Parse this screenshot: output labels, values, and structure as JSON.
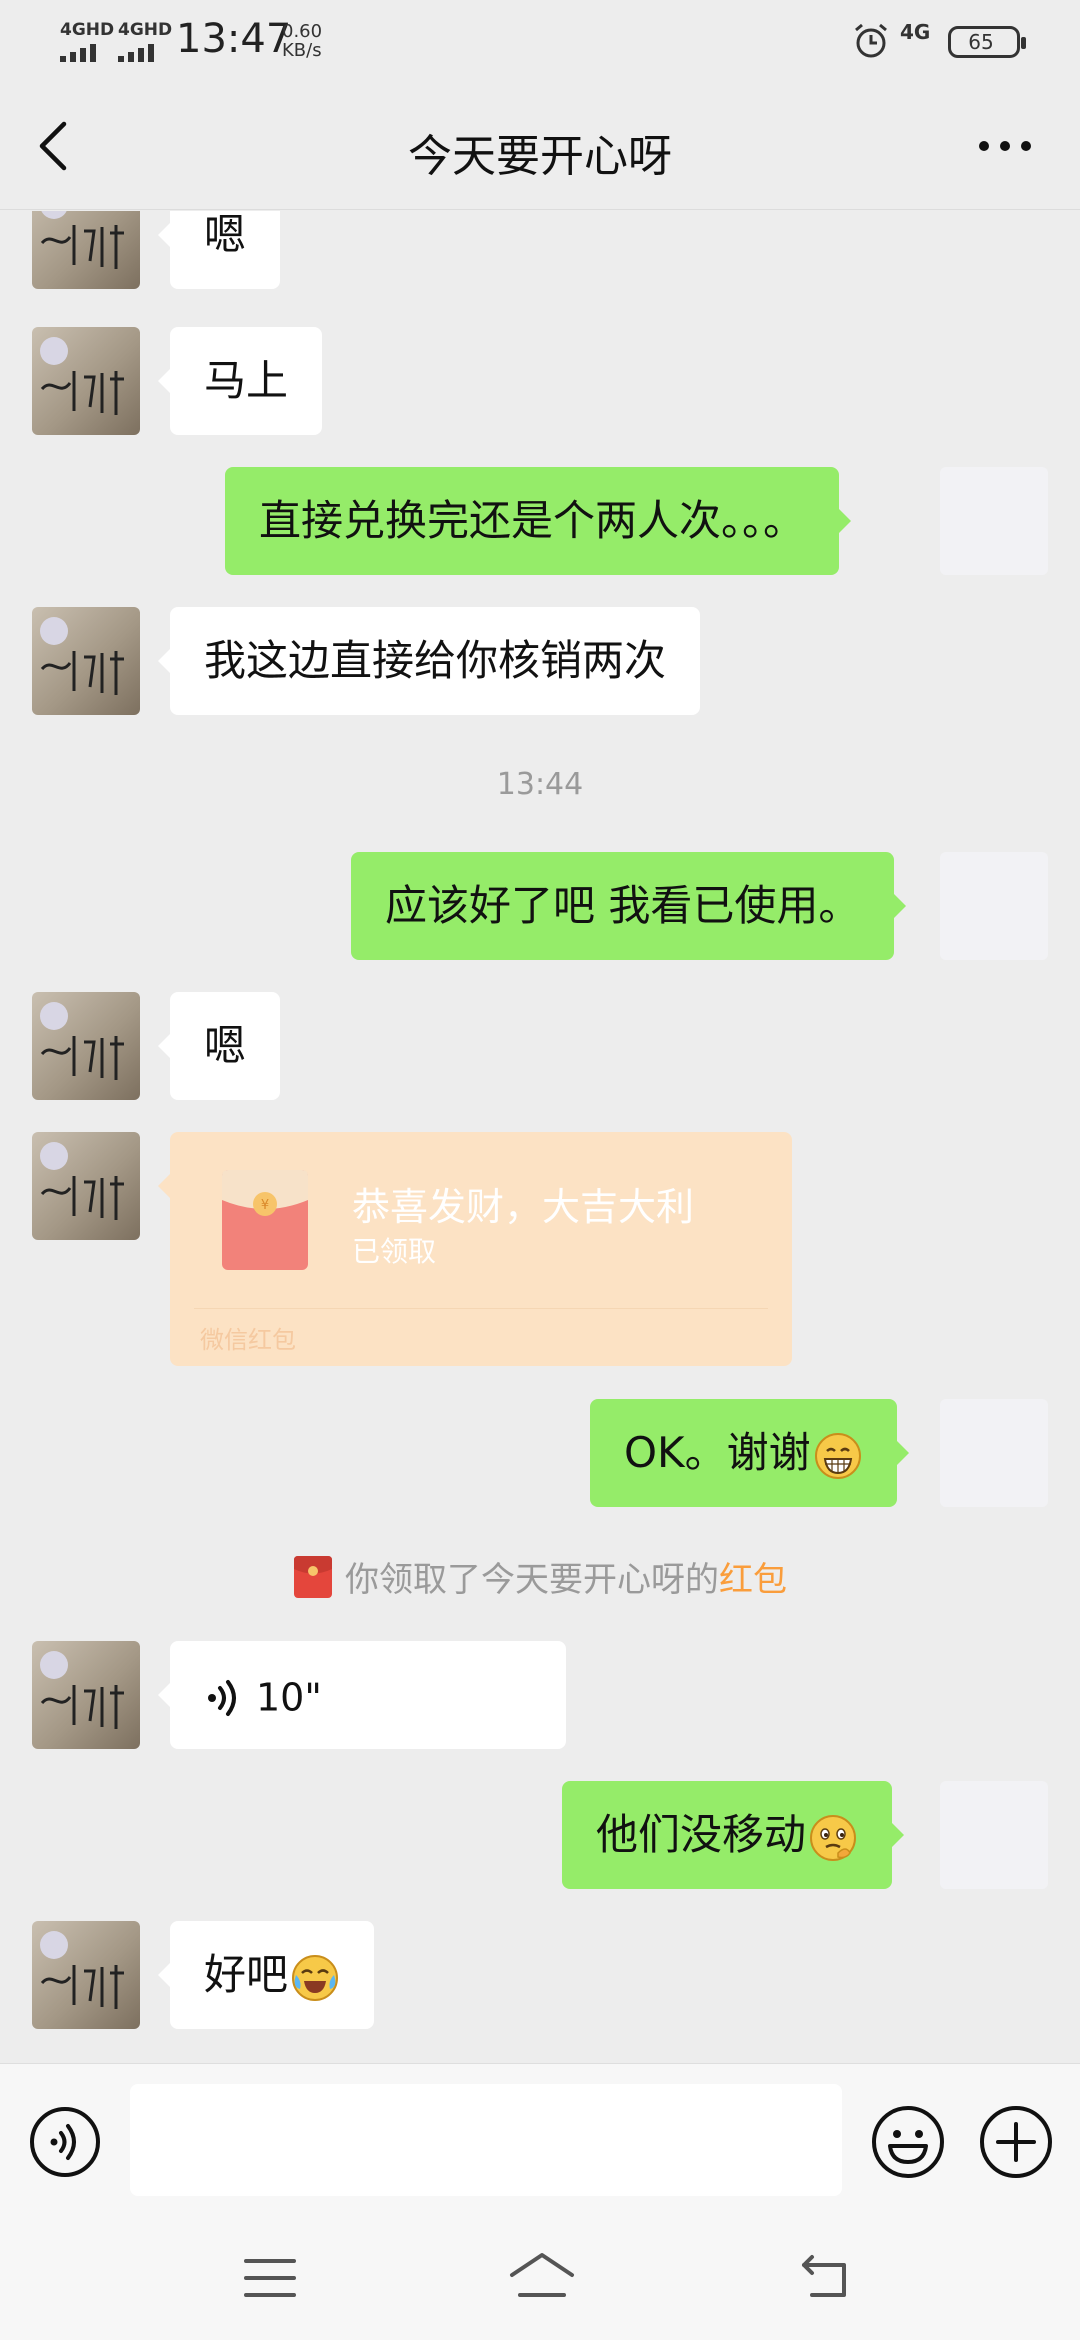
{
  "status_bar": {
    "signal1": "4GHD",
    "signal2": "4GHD",
    "time": "13:47",
    "speed_value": "0.60",
    "speed_unit": "KB/s",
    "network": "4G",
    "battery": "65",
    "alarm_icon": "alarm-icon"
  },
  "nav": {
    "title": "今天要开心呀",
    "back_icon": "chevron-left-icon",
    "more_icon": "more-dots-icon"
  },
  "messages": [
    {
      "side": "in",
      "type": "text",
      "text": "嗯"
    },
    {
      "side": "in",
      "type": "text",
      "text": "马上"
    },
    {
      "side": "out",
      "type": "text",
      "text": "直接兑换完还是个两人次。。。"
    },
    {
      "side": "in",
      "type": "text",
      "text": "我这边直接给你核销两次"
    },
    {
      "type": "time",
      "text": "13:44"
    },
    {
      "side": "out",
      "type": "text",
      "text": "应该好了吧 我看已使用。"
    },
    {
      "side": "in",
      "type": "text",
      "text": "嗯"
    },
    {
      "side": "in",
      "type": "red_packet",
      "title": "恭喜发财，大吉大利",
      "status": "已领取",
      "source": "微信红包"
    },
    {
      "side": "out",
      "type": "text",
      "text": "OK。谢谢",
      "emoji": "grin-emoji-icon"
    },
    {
      "type": "system",
      "prefix": "你领取了今天要开心呀的",
      "link": "红包"
    },
    {
      "side": "in",
      "type": "voice",
      "duration": "10\""
    },
    {
      "side": "out",
      "type": "text",
      "text": "他们没移动",
      "emoji": "thinking-emoji-icon"
    },
    {
      "side": "in",
      "type": "text",
      "text": "好吧",
      "emoji": "crying-laughing-emoji-icon"
    }
  ],
  "input_bar": {
    "voice_icon": "voice-mode-icon",
    "input_value": "",
    "emoji_icon": "emoji-smile-icon",
    "plus_icon": "plus-circle-icon"
  },
  "system_nav": {
    "menu_icon": "menu-icon",
    "home_icon": "home-icon",
    "back_icon": "back-icon"
  },
  "colors": {
    "background": "#EDEDED",
    "out_bubble": "#95EC69",
    "in_bubble": "#FFFFFF",
    "red_packet": "#FCE2C4",
    "link_orange": "#FA9D3B"
  }
}
